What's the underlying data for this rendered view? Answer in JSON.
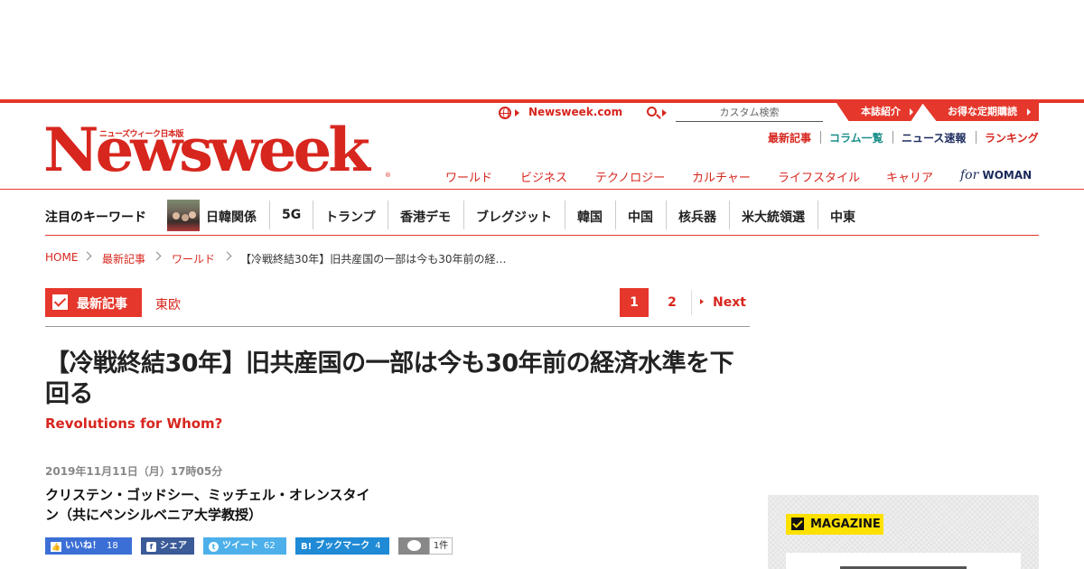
{
  "brand": {
    "sub": "ニューズウィーク日本版",
    "logo": "Newsweek",
    "reg": "®"
  },
  "colors": {
    "accent": "#e5372b",
    "brand_red": "#d7261e",
    "teal": "#1a8f8a",
    "navy": "#1b2a5c",
    "magazine_yellow": "#ffe100"
  },
  "header": {
    "global_link": "Newsweek.com",
    "search_placeholder": "カスタム検索",
    "about_button": "本誌紹介",
    "subscribe_button": "お得な定期購読",
    "sub_links": [
      {
        "label": "最新記事",
        "color": "#d7261e"
      },
      {
        "label": "コラム一覧",
        "color": "#1a8f8a"
      },
      {
        "label": "ニュース速報",
        "color": "#1b2a5c"
      },
      {
        "label": "ランキング",
        "color": "#d7261e"
      }
    ],
    "nav": [
      "ワールド",
      "ビジネス",
      "テクノロジー",
      "カルチャー",
      "ライフスタイル",
      "キャリア"
    ],
    "for_woman": {
      "for": "for",
      "woman": "WOMAN"
    }
  },
  "keywords": {
    "title": "注目のキーワード",
    "items": [
      "日韓関係",
      "5G",
      "トランプ",
      "香港デモ",
      "ブレグジット",
      "韓国",
      "中国",
      "核兵器",
      "米大統領選",
      "中東"
    ]
  },
  "breadcrumb": [
    "HOME",
    "最新記事",
    "ワールド",
    "【冷戦終結30年】旧共産国の一部は今も30年前の経…"
  ],
  "section": {
    "label": "最新記事",
    "category": "東欧"
  },
  "pagination": {
    "current": "1",
    "next_page": "2",
    "next_label": "Next"
  },
  "article": {
    "title": "【冷戦終結30年】旧共産国の一部は今も30年前の経済水準を下回る",
    "subtitle": "Revolutions for Whom?",
    "date": "2019年11月11日（月）17時05分",
    "author": "クリステン・ゴッドシー、ミッチェル・オレンスタイン（共にペンシルベニア大学教授）"
  },
  "share": {
    "facebook": {
      "icon": "thumbs-up-icon",
      "label": "いいね！",
      "count": "18"
    },
    "facebook_share": {
      "icon": "facebook-icon",
      "label": "シェア"
    },
    "twitter": {
      "icon": "twitter-icon",
      "label": "ツイート",
      "count": "62"
    },
    "hatena": {
      "icon": "hatena-bookmark-icon",
      "label": "ブックマーク",
      "count": "4"
    },
    "comments": {
      "icon": "comment-icon",
      "count": "1件"
    }
  },
  "sidebar": {
    "magazine_label": "MAGAZINE"
  }
}
